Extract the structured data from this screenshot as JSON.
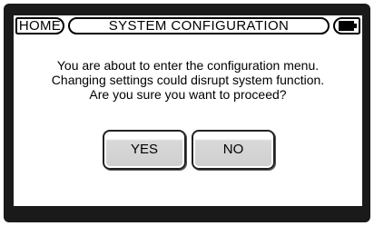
{
  "header": {
    "home_label": "HOME",
    "title": "SYSTEM CONFIGURATION",
    "battery_icon": "battery-icon"
  },
  "dialog": {
    "lines": [
      "You are about to enter the configuration menu.",
      "Changing settings could disrupt system function.",
      "Are you sure you want to proceed?"
    ],
    "yes_label": "YES",
    "no_label": "NO"
  }
}
